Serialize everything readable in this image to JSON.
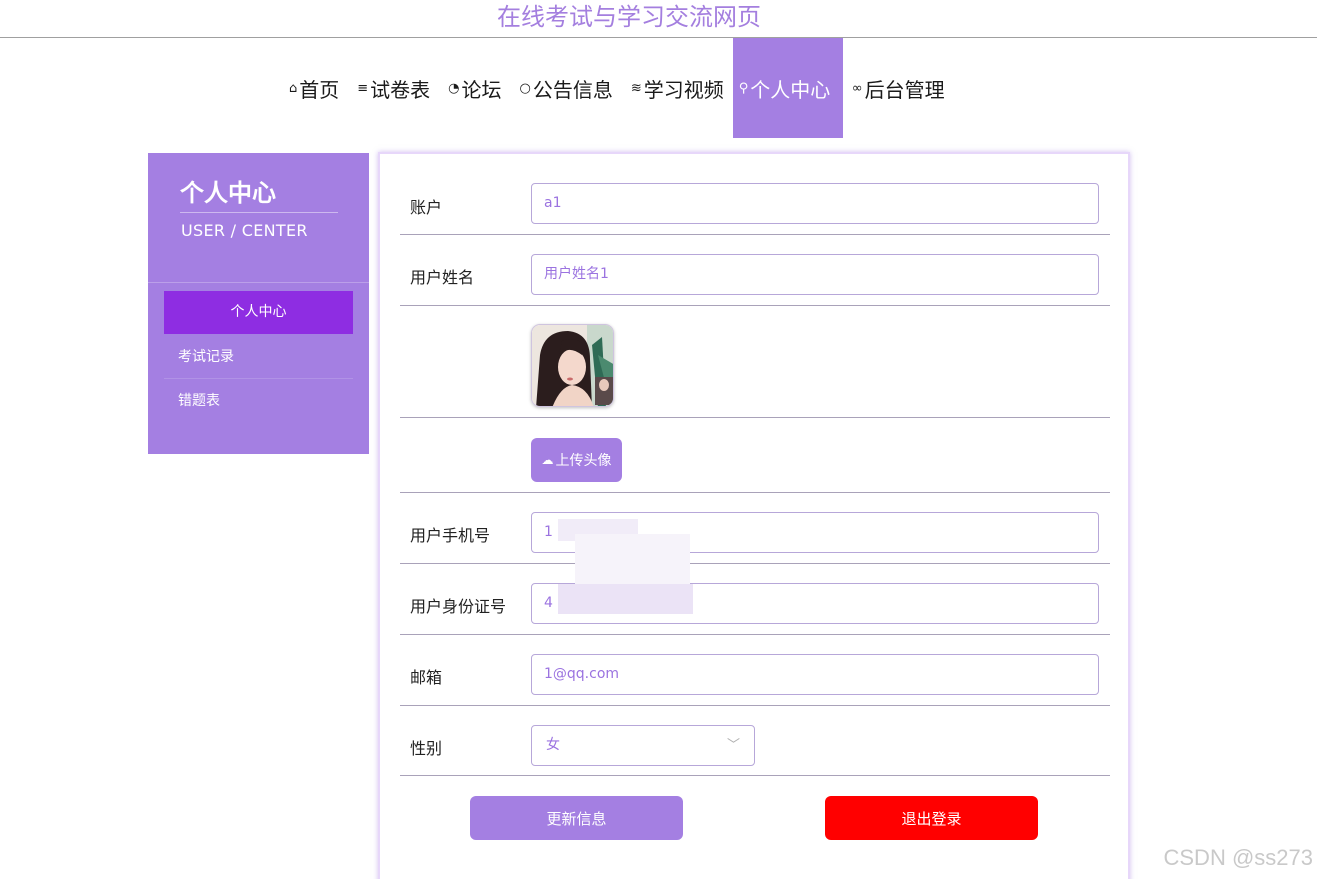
{
  "site": {
    "title": "在线考试与学习交流网页"
  },
  "nav": {
    "items": [
      {
        "icon": "home-icon",
        "glyph": "⌂",
        "label": "首页"
      },
      {
        "icon": "list-icon",
        "glyph": "≡",
        "label": "试卷表"
      },
      {
        "icon": "gauge-icon",
        "glyph": "◔",
        "label": "论坛"
      },
      {
        "icon": "bell-icon",
        "glyph": "○",
        "label": "公告信息"
      },
      {
        "icon": "layers-icon",
        "glyph": "≋",
        "label": "学习视频"
      },
      {
        "icon": "user-icon",
        "glyph": "⚲",
        "label": "个人中心"
      },
      {
        "icon": "link-icon",
        "glyph": "∞",
        "label": "后台管理"
      }
    ],
    "active_index": 5
  },
  "sidebar": {
    "title": "个人中心",
    "subtitle": "USER / CENTER",
    "items": [
      {
        "label": "个人中心"
      },
      {
        "label": "考试记录"
      },
      {
        "label": "错题表"
      }
    ],
    "active_index": 0
  },
  "form": {
    "account": {
      "label": "账户",
      "value": "a1"
    },
    "username": {
      "label": "用户姓名",
      "value": "用户姓名1"
    },
    "avatar": {
      "icon": "avatar-image"
    },
    "upload": {
      "label": "上传头像",
      "icon": "cloud-upload-icon"
    },
    "phone": {
      "label": "用户手机号",
      "value": "1"
    },
    "id_card": {
      "label": "用户身份证号",
      "value": "4"
    },
    "email": {
      "label": "邮箱",
      "value": "1@qq.com"
    },
    "gender": {
      "label": "性别",
      "value": "女"
    }
  },
  "actions": {
    "update_label": "更新信息",
    "logout_label": "退出登录"
  },
  "colors": {
    "accent": "#a47fe2",
    "active_side": "#8e2de2",
    "danger": "#ff0000"
  },
  "watermark": "CSDN @ss273"
}
